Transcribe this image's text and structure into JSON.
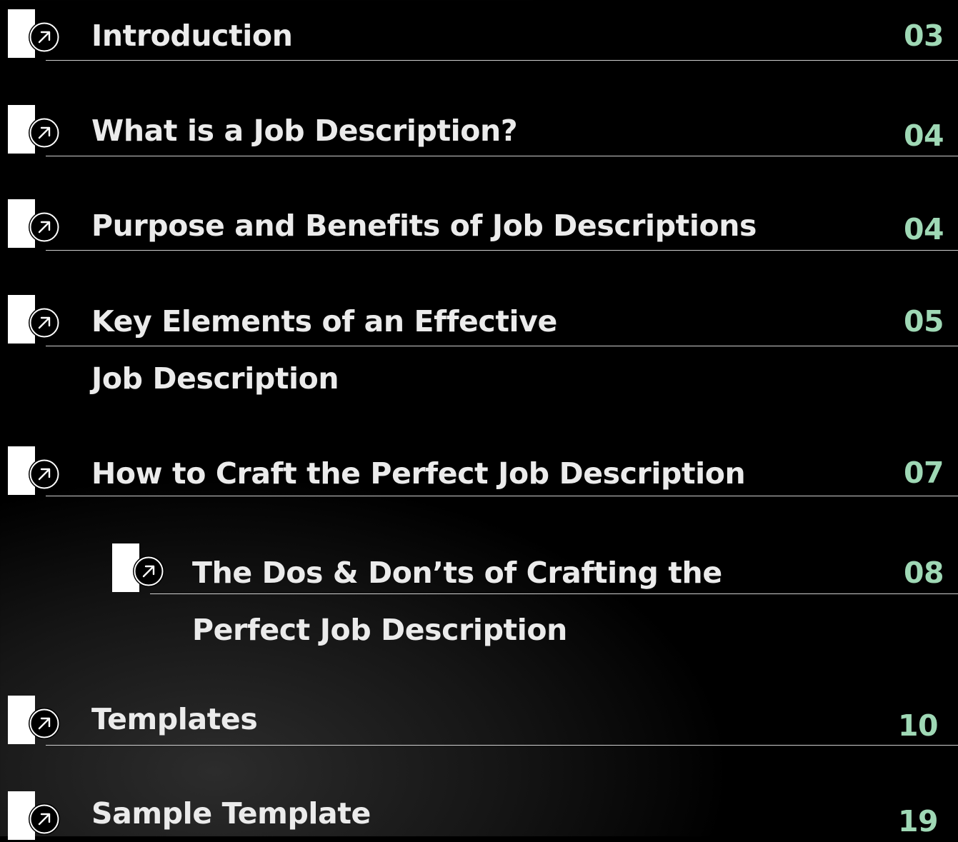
{
  "toc": {
    "accent_color": "#9fd8b5",
    "text_color": "#ebebeb",
    "icon": "arrow-up-right-icon",
    "items": [
      {
        "title": "Introduction",
        "page": "03"
      },
      {
        "title": "What is a Job Description?",
        "page": "04"
      },
      {
        "title": "Purpose and Benefits of Job Descriptions",
        "page": "04"
      },
      {
        "title_line1": "Key Elements of an Effective",
        "title_line2": "Job Description",
        "page": "05"
      },
      {
        "title": "How to Craft the Perfect Job Description",
        "page": "07"
      },
      {
        "title_line1": "The Dos & Don’ts of Crafting the",
        "title_line2": "Perfect Job Description",
        "page": "08"
      },
      {
        "title": "Templates",
        "page": "10"
      },
      {
        "title": "Sample Template",
        "page": "19"
      }
    ]
  }
}
